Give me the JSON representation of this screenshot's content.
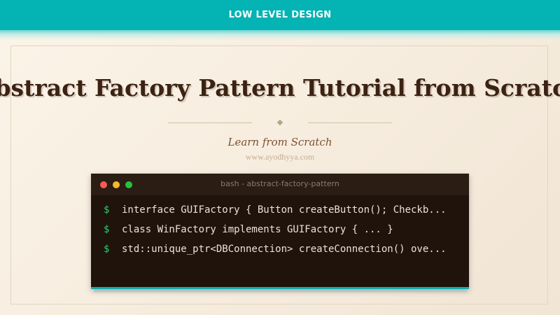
{
  "header": {
    "label": "LOW LEVEL DESIGN"
  },
  "hero": {
    "title": "Abstract Factory Pattern Tutorial from Scratch",
    "subtitle": "Learn from Scratch",
    "website": "www.ayodhyya.com"
  },
  "terminal": {
    "title": "bash - abstract-factory-pattern",
    "prompt": "$",
    "lines": [
      "interface GUIFactory { Button createButton(); Checkb...",
      "class WinFactory implements GUIFactory { ... }",
      "std::unique_ptr<DBConnection> createConnection() ove..."
    ]
  },
  "colors": {
    "header_bg": "#04b3b3",
    "title_text": "#3b2212",
    "terminal_bg": "#1f130c",
    "prompt": "#2ecc71",
    "accent": "#11aeae"
  }
}
